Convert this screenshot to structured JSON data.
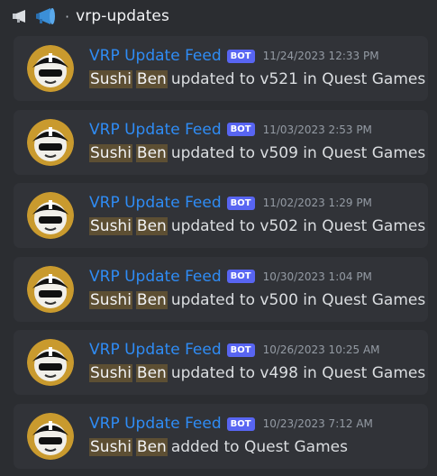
{
  "channel": {
    "name": "vrp-updates",
    "separator": "·",
    "icons": [
      "megaphone-icon",
      "megaphone-icon"
    ]
  },
  "colors": {
    "background": "#2b2d31",
    "card": "#313338",
    "author": "#2f8cf5",
    "bot_tag": "#5865f2",
    "highlight": "#5d4f33",
    "avatar_ring": "#c99a2e"
  },
  "messages": [
    {
      "author": "VRP Update Feed",
      "bot_tag": "BOT",
      "timestamp": "11/24/2023 12:33 PM",
      "hl1": "Sushi",
      "hl2": "Ben",
      "text": "updated to v521 in Quest Games"
    },
    {
      "author": "VRP Update Feed",
      "bot_tag": "BOT",
      "timestamp": "11/03/2023 2:53 PM",
      "hl1": "Sushi",
      "hl2": "Ben",
      "text": "updated to v509 in Quest Games"
    },
    {
      "author": "VRP Update Feed",
      "bot_tag": "BOT",
      "timestamp": "11/02/2023 1:29 PM",
      "hl1": "Sushi",
      "hl2": "Ben",
      "text": "updated to v502 in Quest Games"
    },
    {
      "author": "VRP Update Feed",
      "bot_tag": "BOT",
      "timestamp": "10/30/2023 1:04 PM",
      "hl1": "Sushi",
      "hl2": "Ben",
      "text": "updated to v500 in Quest Games"
    },
    {
      "author": "VRP Update Feed",
      "bot_tag": "BOT",
      "timestamp": "10/26/2023 10:25 AM",
      "hl1": "Sushi",
      "hl2": "Ben",
      "text": "updated to v498 in Quest Games"
    },
    {
      "author": "VRP Update Feed",
      "bot_tag": "BOT",
      "timestamp": "10/23/2023 7:12 AM",
      "hl1": "Sushi",
      "hl2": "Ben",
      "text": "added to Quest Games"
    }
  ]
}
